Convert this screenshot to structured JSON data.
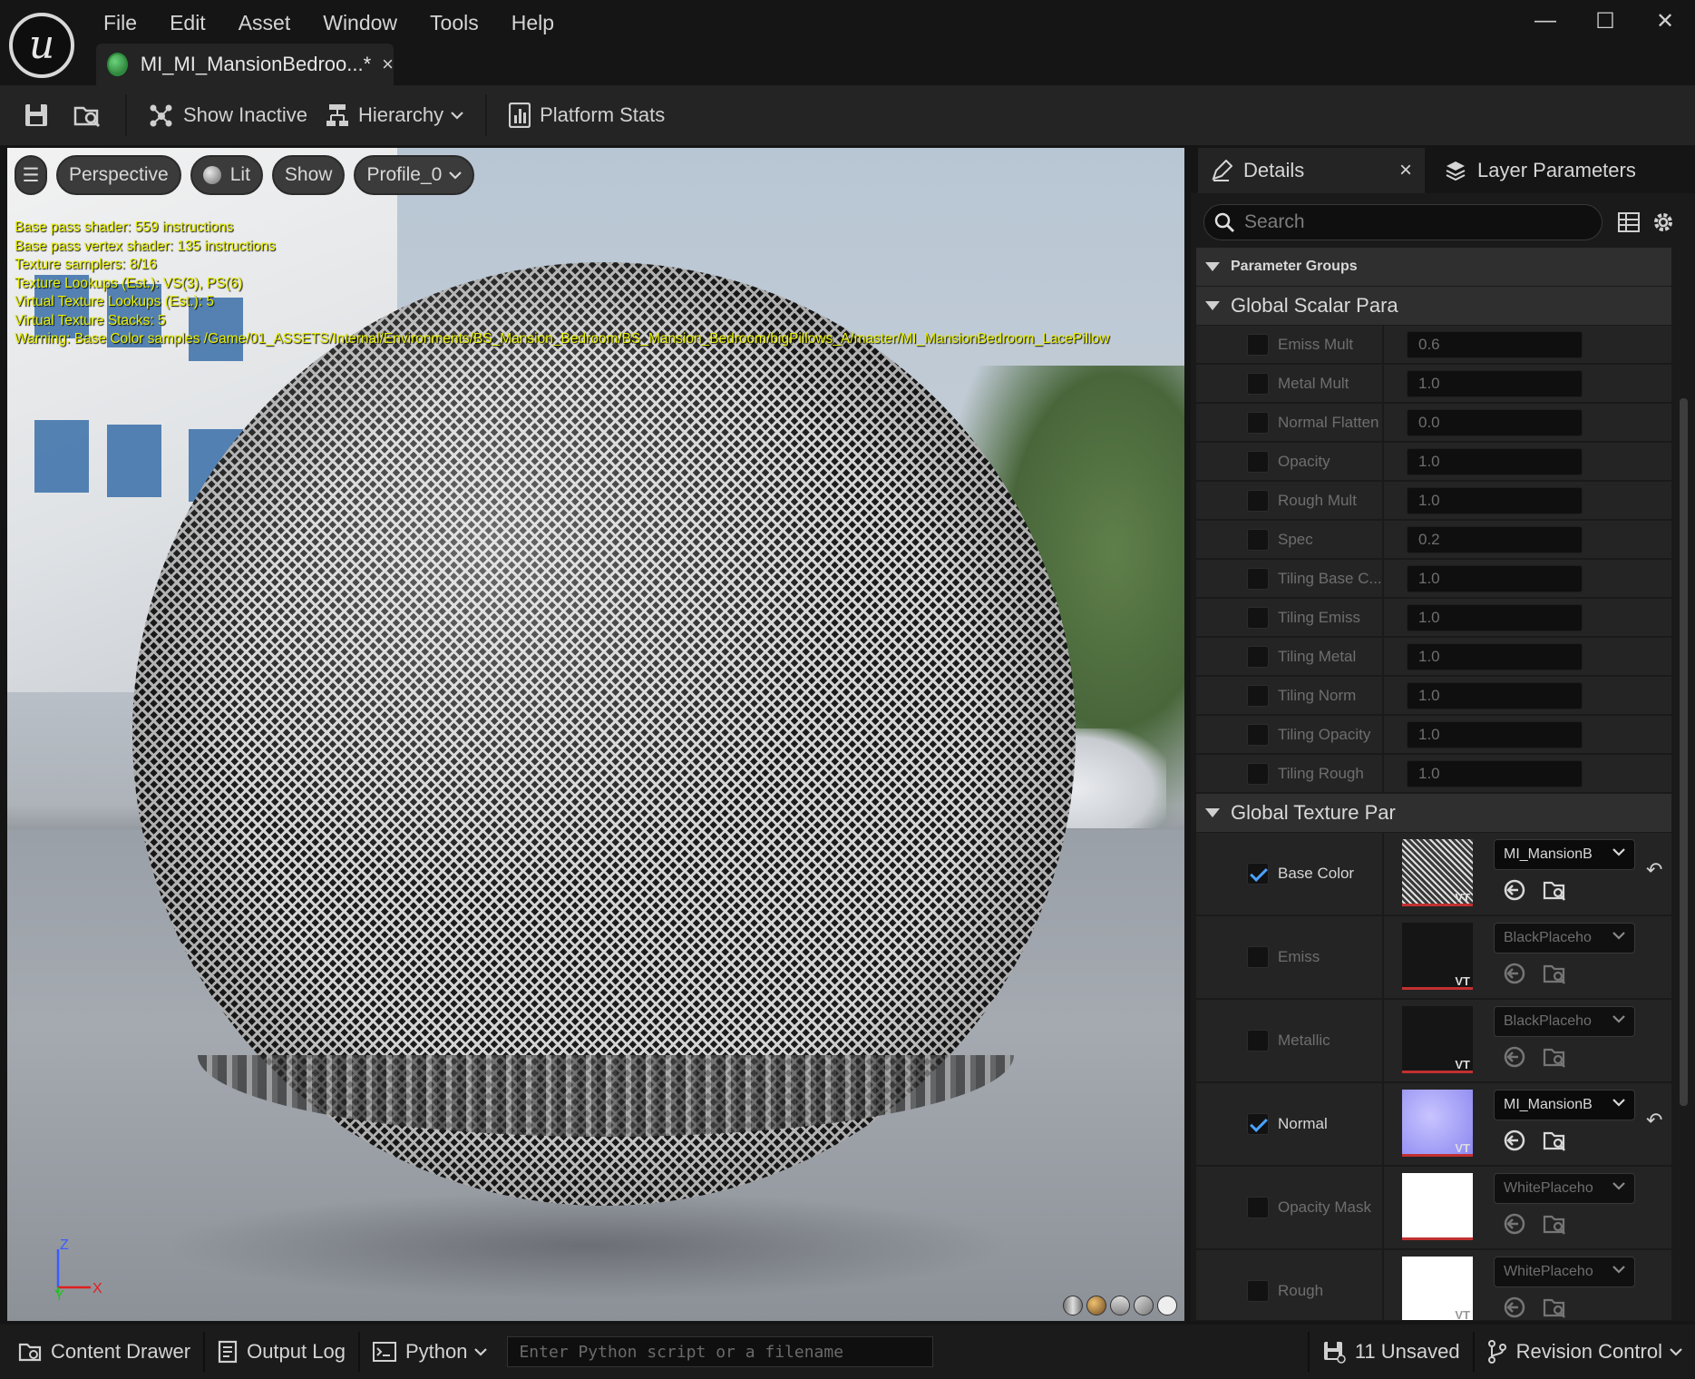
{
  "menu": [
    "File",
    "Edit",
    "Asset",
    "Window",
    "Tools",
    "Help"
  ],
  "logo_text": "u",
  "window_controls": {
    "minimize": "—",
    "maximize": "☐",
    "close": "✕"
  },
  "doc_tab": {
    "label": "MI_MI_MansionBedroo...*",
    "close": "×"
  },
  "toolbar": {
    "show_inactive": "Show Inactive",
    "hierarchy": "Hierarchy",
    "platform_stats": "Platform Stats"
  },
  "viewport": {
    "menu_glyph": "☰",
    "perspective": "Perspective",
    "lit": "Lit",
    "show": "Show",
    "profile": "Profile_0",
    "stats": [
      "Base pass shader: 559 instructions",
      "Base pass vertex shader: 135 instructions",
      "Texture samplers: 8/16",
      "Texture Lookups (Est.): VS(3), PS(6)",
      "Virtual Texture Lookups (Est.): 5",
      "Virtual Texture Stacks: 5",
      "Warning: Base Color samples /Game/01_ASSETS/Internal/Environments/BS_Mansion_Bedroom/BS_Mansion_Bedroom/bigPillows_A/master/MI_MansionBedroom_LacePillow"
    ],
    "axis": {
      "z": "Z",
      "y": "Y",
      "x": "X"
    }
  },
  "panel": {
    "tabs": {
      "details": "Details",
      "details_close": "×",
      "layer_parameters": "Layer Parameters"
    },
    "search_placeholder": "Search",
    "parameter_groups": "Parameter Groups",
    "scalar_group": "Global Scalar Para",
    "scalar_params": [
      {
        "name": "Emiss Mult",
        "value": "0.6"
      },
      {
        "name": "Metal Mult",
        "value": "1.0"
      },
      {
        "name": "Normal Flatten",
        "value": "0.0"
      },
      {
        "name": "Opacity",
        "value": "1.0"
      },
      {
        "name": "Rough Mult",
        "value": "1.0"
      },
      {
        "name": "Spec",
        "value": "0.2"
      },
      {
        "name": "Tiling Base C...",
        "value": "1.0"
      },
      {
        "name": "Tiling Emiss",
        "value": "1.0"
      },
      {
        "name": "Tiling Metal",
        "value": "1.0"
      },
      {
        "name": "Tiling Norm",
        "value": "1.0"
      },
      {
        "name": "Tiling Opacity",
        "value": "1.0"
      },
      {
        "name": "Tiling Rough",
        "value": "1.0"
      }
    ],
    "texture_group": "Global Texture Par",
    "texture_params": [
      {
        "name": "Base Color",
        "asset": "MI_MansionB",
        "checked": true,
        "vt": "VT",
        "reset": "↶"
      },
      {
        "name": "Emiss",
        "asset": "BlackPlaceho",
        "checked": false,
        "vt": "VT",
        "reset": ""
      },
      {
        "name": "Metallic",
        "asset": "BlackPlaceho",
        "checked": false,
        "vt": "VT",
        "reset": ""
      },
      {
        "name": "Normal",
        "asset": "MI_MansionB",
        "checked": true,
        "vt": "VT",
        "reset": "↶"
      },
      {
        "name": "Opacity Mask",
        "asset": "WhitePlaceho",
        "checked": false,
        "vt": "",
        "reset": ""
      },
      {
        "name": "Rough",
        "asset": "WhitePlaceho",
        "checked": false,
        "vt": "VT",
        "reset": ""
      }
    ]
  },
  "statusbar": {
    "content_drawer": "Content Drawer",
    "output_log": "Output Log",
    "python": "Python",
    "console_placeholder": "Enter Python script or a filename",
    "unsaved": "11 Unsaved",
    "revision_control": "Revision Control"
  },
  "colors": {
    "accent": "#4aa3ff",
    "stats_text": "#e8f000",
    "panel_bg": "#242424"
  }
}
